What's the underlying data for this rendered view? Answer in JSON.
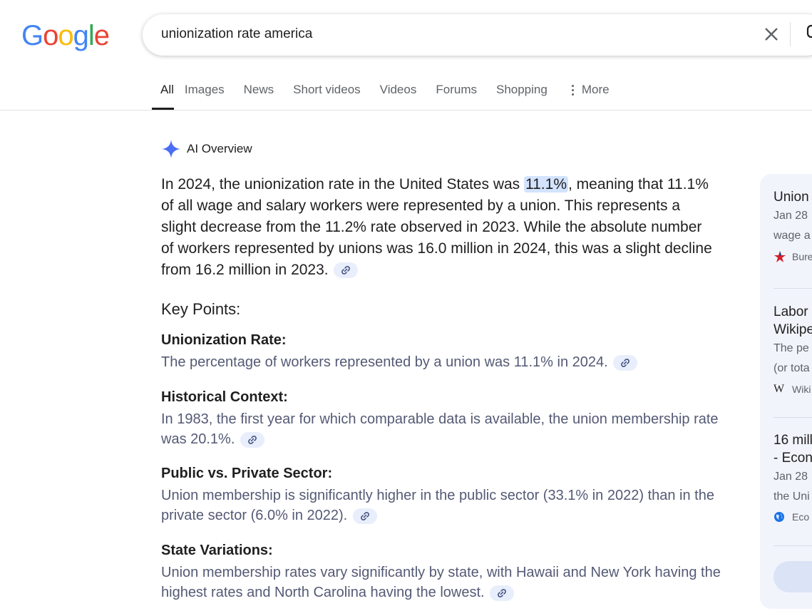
{
  "logo": {
    "letters": [
      "G",
      "o",
      "o",
      "g",
      "l",
      "e"
    ]
  },
  "search": {
    "query": "unionization rate america"
  },
  "tabs": [
    "All",
    "Images",
    "News",
    "Short videos",
    "Videos",
    "Forums",
    "Shopping",
    "More"
  ],
  "ai_overview": {
    "label": "AI Overview",
    "summary_before": "In 2024, the unionization rate in the United States was ",
    "summary_highlight": "11.1%",
    "summary_after": ", meaning that 11.1% of all wage and salary workers were represented by a union. This represents a slight decrease from the 11.2% rate observed in 2023. While the absolute number of workers represented by unions was 16.0 million in 2024, this was a slight decline from 16.2 million in 2023.",
    "key_points_title": "Key Points:",
    "points": [
      {
        "heading": "Unionization Rate:",
        "body": "The percentage of workers represented by a union was 11.1% in 2024."
      },
      {
        "heading": "Historical Context:",
        "body": "In 1983, the first year for which comparable data is available, the union membership rate was 20.1%."
      },
      {
        "heading": "Public vs. Private Sector:",
        "body": "Union membership is significantly higher in the public sector (33.1% in 2022) than in the private sector (6.0% in 2022)."
      },
      {
        "heading": "State Variations:",
        "body": "Union membership rates vary significantly by state, with Hawaii and New York having the highest rates and North Carolina having the lowest."
      }
    ]
  },
  "sources": [
    {
      "title_lines": [
        "Union"
      ],
      "snippet_lines": [
        "Jan 28",
        "wage a"
      ],
      "site": "Bure"
    },
    {
      "title_lines": [
        "Labor",
        "Wikipe"
      ],
      "snippet_lines": [
        "The pe",
        "(or tota"
      ],
      "site": "Wiki"
    },
    {
      "title_lines": [
        "16 mill",
        "- Econ"
      ],
      "snippet_lines": [
        "Jan 28",
        "the Uni"
      ],
      "site": "Eco"
    }
  ],
  "colors": {
    "accent": "#0b57d0",
    "highlight": "#d3e3fd",
    "chip": "#e8eefb",
    "panel": "#f1f4fb"
  }
}
